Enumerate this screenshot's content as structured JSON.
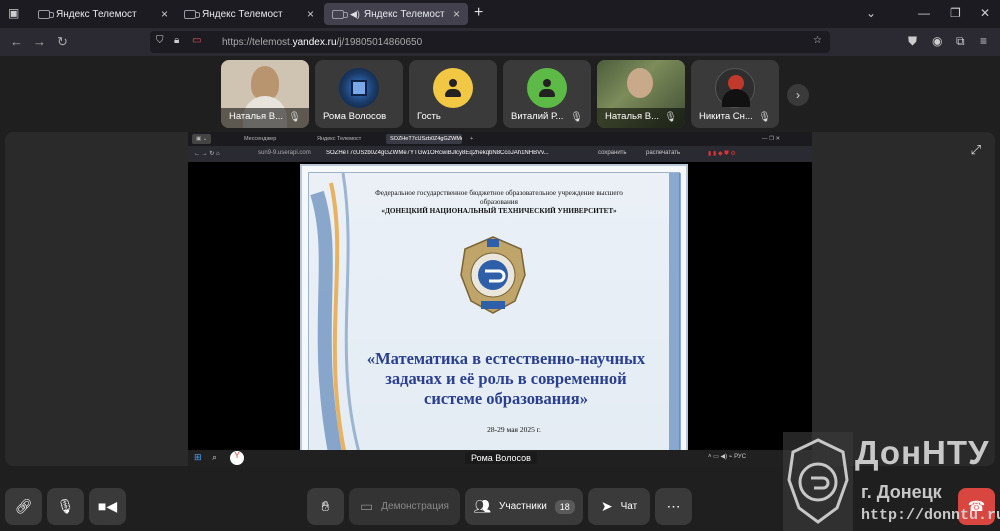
{
  "browser": {
    "tabs": [
      {
        "label": "Яндекс Телемост",
        "active": false
      },
      {
        "label": "Яндекс Телемост",
        "active": false
      },
      {
        "label": "Яндекс Телемост",
        "active": true
      }
    ],
    "url_prefix": "https://telemost.",
    "url_host": "yandex.ru",
    "url_path": "/j/19805014860650"
  },
  "participants": [
    {
      "name": "Наталья В...",
      "type": "video",
      "avatar_color": "#c9b59e"
    },
    {
      "name": "Рома Волосов",
      "type": "image",
      "avatar_color": "#1a3a66"
    },
    {
      "name": "Гость",
      "type": "placeholder",
      "avatar_color": "#f2c744"
    },
    {
      "name": "Виталий Р...",
      "type": "placeholder",
      "avatar_color": "#5dba47"
    },
    {
      "name": "Наталья В...",
      "type": "video",
      "avatar_color": "#6b7a56"
    },
    {
      "name": "Никита Сн...",
      "type": "image",
      "avatar_color": "#2e2e2e"
    }
  ],
  "shared_screen": {
    "inner_tabs": [
      "Мессенджер",
      "Яндекс Телемост",
      "SOZHeT7cUSzb0Z4gGZWMe7Y..."
    ],
    "inner_url_host": "sun9-9.userapi.com",
    "inner_url_title": "SOZHeT7cUSzb0Z4gGZWMe7YTGw1ORcwiBJlcy8Eq2hekqbN8CcoJAh1NHBVv...",
    "inner_btn_save": "сохранить",
    "inner_btn_print": "распечатать",
    "slide": {
      "org_line1": "Федеральное государственное бюджетное образовательное учреждение высшего",
      "org_line2": "образования",
      "org_line3": "«ДОНЕЦКИЙ НАЦИОНАЛЬНЫЙ ТЕХНИЧЕСКИЙ УНИВЕРСИТЕТ»",
      "title_line1": "«Математика в естественно-научных",
      "title_line2": "задачах и её роль в современной",
      "title_line3": "системе образования»",
      "date": "28-29 мая 2025 г."
    },
    "presenter_label": "Рома Волосов"
  },
  "controls": {
    "demo_label": "Демонстрация",
    "participants_label": "Участники",
    "participants_count": "18",
    "chat_label": "Чат"
  },
  "watermark": {
    "line1": "ДонНТУ",
    "line2": "г. Донецк",
    "line3": "http://donntu.ru"
  }
}
